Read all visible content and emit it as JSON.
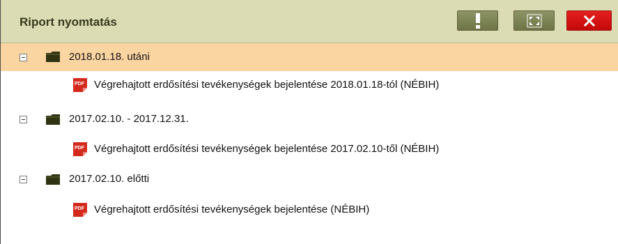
{
  "window": {
    "title": "Riport nyomtatás",
    "buttons": {
      "info_symbol": "!",
      "close_symbol": "✕"
    }
  },
  "tree": {
    "groups": [
      {
        "label": "2018.01.18. utáni",
        "selected": true,
        "items": [
          {
            "label": "Végrehajtott erdősítési tevékenységek bejelentése 2018.01.18-tól (NÉBIH)"
          }
        ]
      },
      {
        "label": "2017.02.10. - 2017.12.31.",
        "selected": false,
        "items": [
          {
            "label": "Végrehajtott erdősítési tevékenységek bejelentése 2017.02.10-től (NÉBIH)"
          }
        ]
      },
      {
        "label": "2017.02.10. előtti",
        "selected": false,
        "items": [
          {
            "label": "Végrehajtott erdősítési tevékenységek bejelentése (NÉBIH)"
          }
        ]
      }
    ]
  },
  "icons": {
    "pdf_text": "PDF",
    "toggle": "minus-box-icon",
    "folder": "folder-icon",
    "file": "pdf-icon",
    "maximize": "expand-icon"
  },
  "colors": {
    "titlebar_bg": "#dcdcb4",
    "selected_row_bg": "#fbd5a1",
    "close_button": "#d41010"
  }
}
